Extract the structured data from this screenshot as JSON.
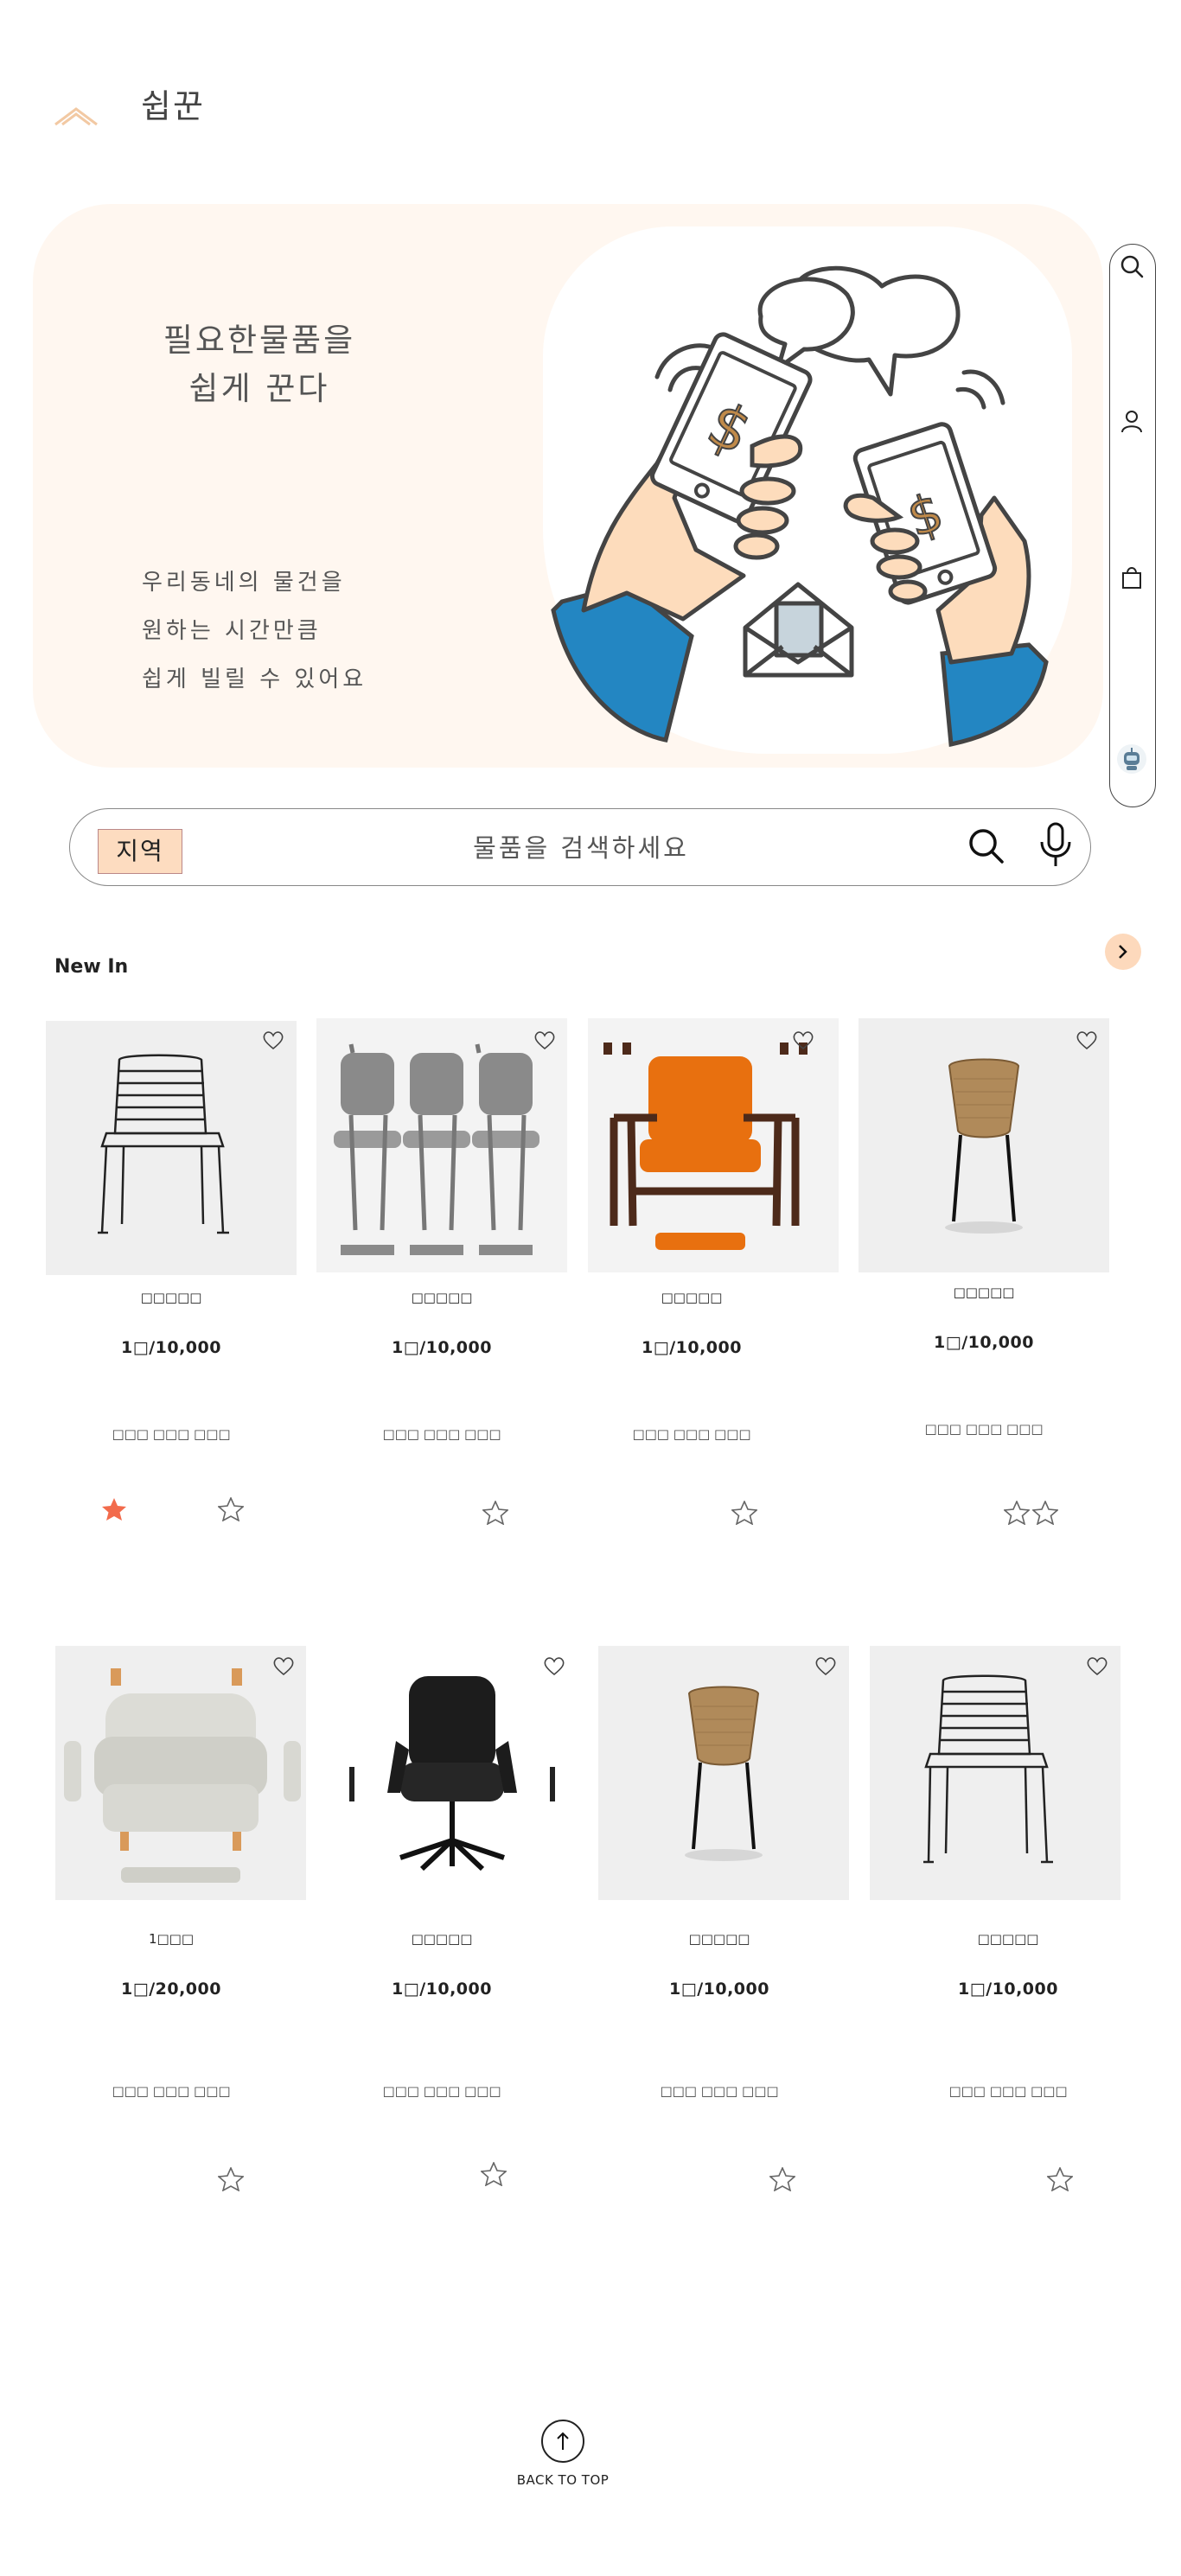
{
  "header": {
    "logo_text": "쉽꾼",
    "logo_icon": "chevron-up-logo"
  },
  "hero": {
    "title_line1": "필요한물품을",
    "title_line2": "쉽게 꾼다",
    "sub_line1": "우리동네의 물건을",
    "sub_line2": "원하는 시간만큼",
    "sub_line3": "쉽게 빌릴 수 있어요",
    "illustration": "hands-exchanging-money-phones"
  },
  "side_rail": {
    "icons": [
      "search-icon",
      "user-icon",
      "shopping-bag-icon",
      "chatbot-icon"
    ]
  },
  "search": {
    "region_label": "지역",
    "placeholder": "물품을 검색하세요"
  },
  "section": {
    "title": "New In",
    "next_icon": "chevron-right"
  },
  "products": [
    {
      "name": "□□□□□",
      "price": "1□/10,000",
      "desc": "□□□ □□□ □□□",
      "stars": [
        true,
        false
      ],
      "image": "wire-chair"
    },
    {
      "name": "□□□□□",
      "price": "1□/10,000",
      "desc": "□□□ □□□ □□□",
      "stars": [
        false
      ],
      "image": "grey-chairs-row"
    },
    {
      "name": "□□□□□",
      "price": "1□/10,000",
      "desc": "□□□ □□□ □□□",
      "stars": [
        false
      ],
      "image": "orange-armchair"
    },
    {
      "name": "□□□□□",
      "price": "1□/10,000",
      "desc": "□□□ □□□ □□□",
      "stars": [
        false,
        false
      ],
      "image": "wicker-chair"
    },
    {
      "name": "1□□□",
      "price": "1□/20,000",
      "desc": "□□□ □□□ □□□",
      "stars": [
        false
      ],
      "image": "white-sofa-chair"
    },
    {
      "name": "□□□□□",
      "price": "1□/10,000",
      "desc": "□□□ □□□ □□□",
      "stars": [
        false
      ],
      "image": "black-office-chair"
    },
    {
      "name": "□□□□□",
      "price": "1□/10,000",
      "desc": "□□□ □□□ □□□",
      "stars": [
        false
      ],
      "image": "wicker-chair"
    },
    {
      "name": "□□□□□",
      "price": "1□/10,000",
      "desc": "□□□ □□□ □□□",
      "stars": [
        false
      ],
      "image": "wire-chair"
    }
  ],
  "footer": {
    "back_to_top": "BACK TO TOP"
  },
  "colors": {
    "accent": "#fdd9bc",
    "hero_bg": "#fff7f0",
    "star_filled": "#f26b4c",
    "sleeve": "#2386c2"
  }
}
